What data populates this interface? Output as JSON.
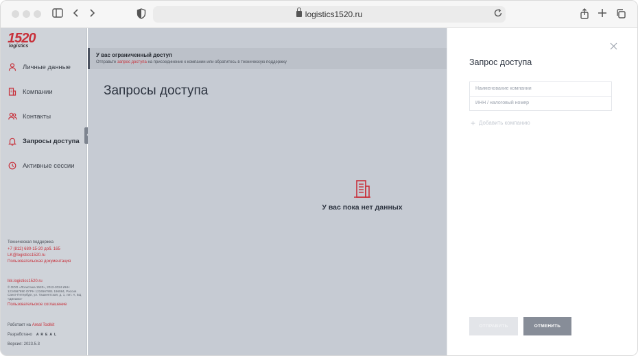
{
  "browser": {
    "url": "logistics1520.ru"
  },
  "logo": {
    "number": "1520",
    "word": "logistics",
    "brand_color": "#c8303a"
  },
  "sidebar": {
    "items": [
      {
        "label": "Личные данные",
        "icon": "user-icon"
      },
      {
        "label": "Компании",
        "icon": "building-icon"
      },
      {
        "label": "Контакты",
        "icon": "contacts-icon"
      },
      {
        "label": "Запросы доступа",
        "icon": "bell-icon"
      },
      {
        "label": "Активные сессии",
        "icon": "clock-icon"
      }
    ],
    "active_index": 3,
    "footer": {
      "support_title": "Техническая поддержка",
      "phone": "+7 (812) 680-15-20 доб. 165",
      "email": "LK@logistics1520.ru",
      "docs_link": "Пользовательская документация",
      "site_link": "lkk.logistics1520.ru",
      "legal": "© ООО «Логистика 1520», 2012-2024 ИНН 1234567890 ОГРН 1234567891 196084, Россия Санкт-Петербург, ул. Ташкентская, д. 1, лит. А, БЦ «Динамо»",
      "agreement_link": "Пользовательское соглашение",
      "works_on_prefix": "Работает на",
      "works_on_link": "Areal Toolkit",
      "developed_by": "Разработано",
      "developer_logo": "AREAL",
      "version": "Версия: 2023.5.3"
    }
  },
  "notice": {
    "title": "У вас ограниченный доступ",
    "text_prefix": "Отправьте",
    "text_link": "запрос доступа",
    "text_suffix": "на присоединение к компании или обратитесь в техническую поддержку"
  },
  "main": {
    "page_title": "Запросы доступа",
    "empty_text": "У вас пока нет данных"
  },
  "panel": {
    "title": "Запрос доступа",
    "company_placeholder": "Наименование компании",
    "inn_placeholder": "ИНН / налоговый номер",
    "add_company_label": "Добавить компанию",
    "send_label": "ОТПРАВИТЬ",
    "cancel_label": "ОТМЕНИТЬ"
  }
}
